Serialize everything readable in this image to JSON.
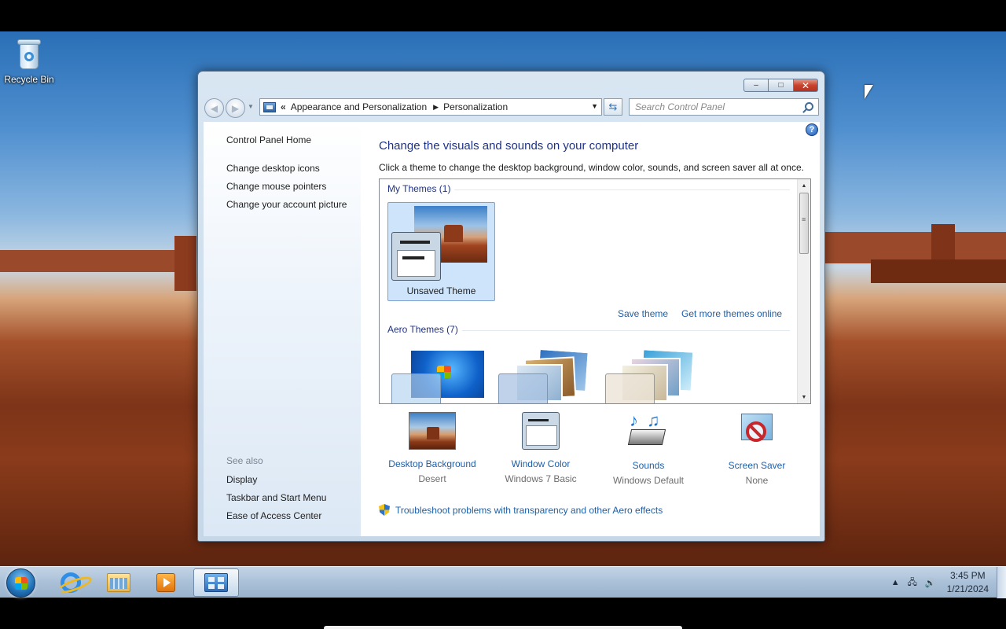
{
  "desktop": {
    "recycle_bin_label": "Recycle Bin"
  },
  "window": {
    "controls": {
      "minimize": "–",
      "maximize": "□",
      "close": "✕"
    },
    "address": {
      "chevron": "«",
      "segment1": "Appearance and Personalization",
      "separator": "▶",
      "segment2": "Personalization"
    },
    "search_placeholder": "Search Control Panel",
    "sidebar": {
      "home": "Control Panel Home",
      "links": [
        "Change desktop icons",
        "Change mouse pointers",
        "Change your account picture"
      ],
      "see_also_label": "See also",
      "see_also": [
        "Display",
        "Taskbar and Start Menu",
        "Ease of Access Center"
      ]
    },
    "main": {
      "title": "Change the visuals and sounds on your computer",
      "description": "Click a theme to change the desktop background, window color, sounds, and screen saver all at once.",
      "my_themes_header": "My Themes (1)",
      "selected_theme": "Unsaved Theme",
      "save_theme": "Save theme",
      "more_themes": "Get more themes online",
      "aero_themes_header": "Aero Themes (7)",
      "settings": [
        {
          "name": "Desktop Background",
          "value": "Desert"
        },
        {
          "name": "Window Color",
          "value": "Windows 7 Basic"
        },
        {
          "name": "Sounds",
          "value": "Windows Default"
        },
        {
          "name": "Screen Saver",
          "value": "None"
        }
      ],
      "troubleshoot": "Troubleshoot problems with transparency and other Aero effects"
    }
  },
  "taskbar": {
    "time": "3:45 PM",
    "date": "1/21/2024"
  }
}
